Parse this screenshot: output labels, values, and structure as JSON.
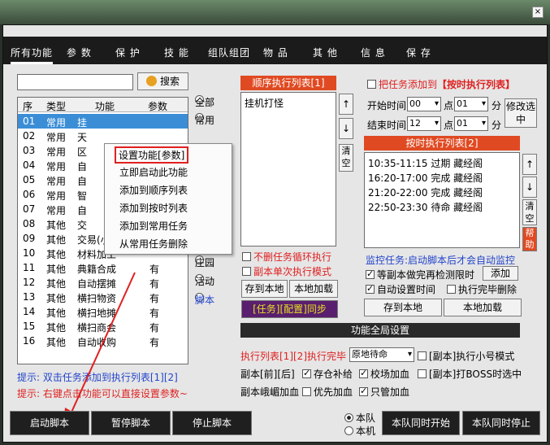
{
  "window": {
    "close_glyph": "×"
  },
  "nav": {
    "tabs": [
      "所有功能",
      "参 数",
      "保 护",
      "技 能",
      "组队组团",
      "物 品",
      "其 他",
      "信 息",
      "保 存"
    ]
  },
  "search": {
    "value": "",
    "button_label": "搜索",
    "icon": "search-icon"
  },
  "table": {
    "headers": [
      "序",
      "类型",
      "功能",
      "参数"
    ],
    "rows": [
      {
        "no": "01",
        "type": "常用",
        "func": "挂",
        "param": ""
      },
      {
        "no": "02",
        "type": "常用",
        "func": "天",
        "param": ""
      },
      {
        "no": "03",
        "type": "常用",
        "func": "区",
        "param": ""
      },
      {
        "no": "04",
        "type": "常用",
        "func": "自",
        "param": ""
      },
      {
        "no": "05",
        "type": "常用",
        "func": "自",
        "param": ""
      },
      {
        "no": "06",
        "type": "常用",
        "func": "智",
        "param": ""
      },
      {
        "no": "07",
        "type": "常用",
        "func": "自",
        "param": ""
      },
      {
        "no": "08",
        "type": "其他",
        "func": "交",
        "param": ""
      },
      {
        "no": "09",
        "type": "其他",
        "func": "交易(小号)",
        "param": "有"
      },
      {
        "no": "10",
        "type": "其他",
        "func": "材料加工",
        "param": ""
      },
      {
        "no": "11",
        "type": "其他",
        "func": "典籍合成",
        "param": "有"
      },
      {
        "no": "12",
        "type": "其他",
        "func": "自动摆摊",
        "param": "有"
      },
      {
        "no": "13",
        "type": "其他",
        "func": "横扫物资",
        "param": "有"
      },
      {
        "no": "14",
        "type": "其他",
        "func": "横扫地摊",
        "param": "有"
      },
      {
        "no": "15",
        "type": "其他",
        "func": "横扫商会",
        "param": "有"
      },
      {
        "no": "16",
        "type": "其他",
        "func": "自动收购",
        "param": "有"
      }
    ]
  },
  "filters": [
    "全部",
    "常用",
    "其他",
    "庄园",
    "活动",
    "脚本"
  ],
  "context_menu": [
    "设置功能[参数]",
    "立即启动此功能",
    "添加到顺序列表",
    "添加到按时列表",
    "添加到常用任务",
    "从常用任务删除"
  ],
  "seq": {
    "title": "顺序执行列表[1]",
    "items": [
      "挂机打怪"
    ],
    "up": "↑",
    "down": "↓",
    "clear": "清空",
    "no_delete_loop": "不删任务循环执行",
    "single_mode": "副本单次执行模式",
    "save_local": "存到本地",
    "load_local": "本地加载",
    "sync": "[任务][配置]同步"
  },
  "timed": {
    "add_check": "把任务添加到",
    "add_target": "【按时执行列表】",
    "start_label": "开始时间",
    "end_label": "结束时间",
    "hour_label": "点",
    "min_label": "分",
    "start_h": "00",
    "start_m": "01",
    "end_h": "12",
    "end_m": "01",
    "modify": "修改选中",
    "title": "按时执行列表[2]",
    "items": [
      {
        "time": "10:35-11:15",
        "status": "过期",
        "name": "藏经阁"
      },
      {
        "time": "16:20-17:00",
        "status": "完成",
        "name": "藏经阁"
      },
      {
        "time": "21:20-22:00",
        "status": "完成",
        "name": "藏经阁"
      },
      {
        "time": "22:50-23:30",
        "status": "待命",
        "name": "藏经阁"
      }
    ],
    "up": "↑",
    "down": "↓",
    "clear": "清空",
    "help": "帮助"
  },
  "monitor": {
    "text": "监控任务:启动脚本后才会自动监控",
    "wait_check": "等副本做完再检测限时",
    "add": "添加",
    "auto_time": "自动设置时间",
    "delete_done": "执行完毕删除",
    "save_local": "存到本地",
    "load_local": "本地加载"
  },
  "global": {
    "title": "功能全局设置",
    "exec_done_label": "执行列表[1][2]执行完毕",
    "exec_done_value": "原地待命",
    "small_mode": "[副本]执行小号模式",
    "front_back": "副本[前][后]",
    "storage": "存仓补给",
    "field_hp": "校场加血",
    "boss_fight": "[副本]打BOSS时选中",
    "ridge_hp": "副本峨嵋加血",
    "prio_hp": "优先加血",
    "only_hp": "只管加血"
  },
  "tips": {
    "tip1": "提示: 双击任务添加到执行列表[1][2]",
    "tip2": "提示: 右键点击功能可以直接设置参数~"
  },
  "bottom": {
    "start": "启动脚本",
    "pause": "暂停脚本",
    "stop": "停止脚本",
    "team": "本队",
    "local": "本机",
    "team_start": "本队同时开始",
    "team_stop": "本队同时停止"
  }
}
